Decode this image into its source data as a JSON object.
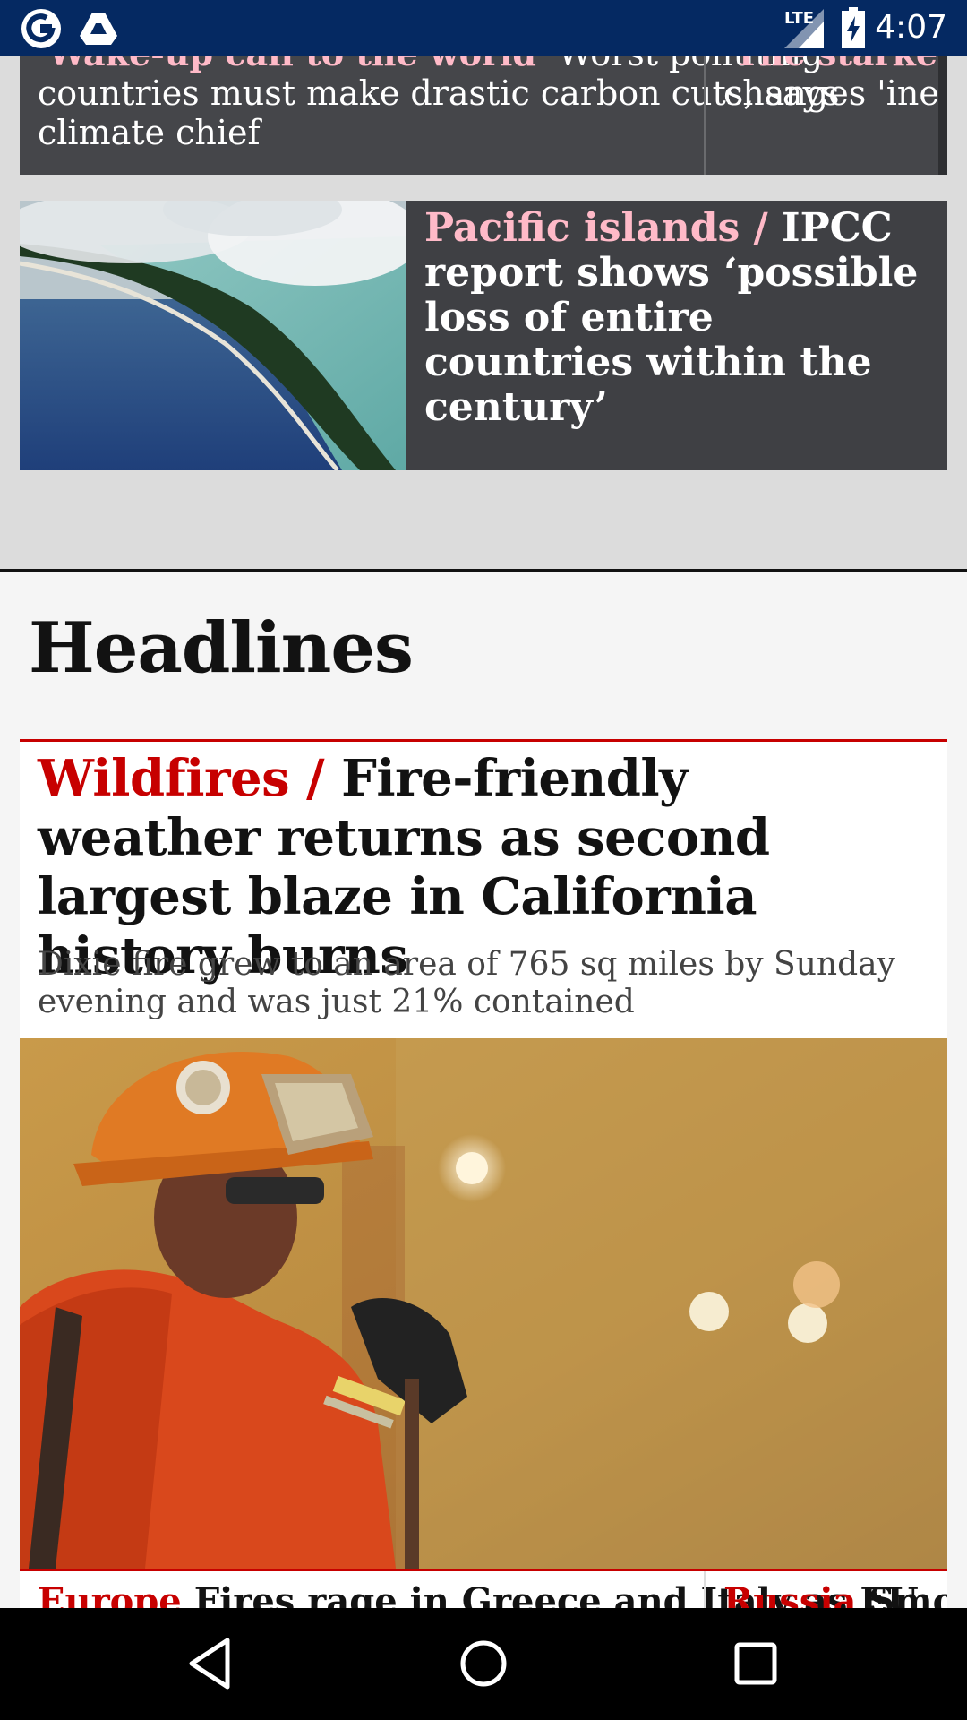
{
  "status_bar": {
    "time": "4:07",
    "network": "LTE",
    "icons": [
      "guardian-logo-icon",
      "drive-icon",
      "lte-signal-icon",
      "battery-charging-icon"
    ]
  },
  "carousel": {
    "cards": [
      {
        "kicker": "'Wake-up call to the world'",
        "headline": "Worst polluting countries must make drastic carbon cuts, says climate chief"
      },
      {
        "kicker": "'The starkest w",
        "headline": "changes 'inevita"
      }
    ],
    "lines": {
      "card1_line1_kicker": "'Wake-up call to the world'",
      "card1_line1_text": " Worst polluting",
      "card1_line2": "countries must make drastic carbon cuts, says",
      "card1_line3": "climate chief",
      "card2_line1_kicker": "'The starkest w",
      "card2_line2": "changes 'inevita"
    }
  },
  "pacific": {
    "kicker": "Pacific islands /",
    "headline": "IPCC report shows ‘possible loss of entire countries within the century’",
    "image": "aerial-island-photo"
  },
  "headlines": {
    "title": "Headlines",
    "main": {
      "kicker": "Wildfires /",
      "headline": "Fire-friendly weather returns as second largest blaze in California history burns",
      "standfirst": "Dixie fire grew to an area of 765 sq miles by Sunday evening and was just 21% contained",
      "image": "firefighter-photo"
    },
    "next": [
      {
        "kicker": "Europe",
        "headline": "Fires rage in Greece and Italy as EU"
      },
      {
        "kicker": "Russia",
        "headline": "Smoke f"
      }
    ]
  },
  "colors": {
    "guardian_blue": "#052962",
    "news_red": "#c70000",
    "pink_kicker": "#ffbac8",
    "card_dark": "#3f4044"
  },
  "nav_bar": [
    "back-icon",
    "home-icon",
    "recents-icon"
  ]
}
